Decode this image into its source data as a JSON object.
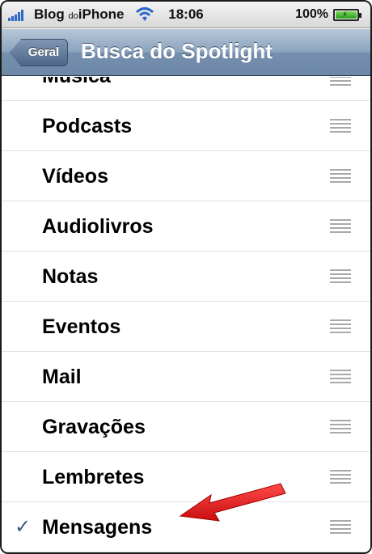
{
  "status_bar": {
    "carrier_main": "Blog",
    "carrier_small": "do",
    "carrier_end": "iPhone",
    "time": "18:06",
    "battery_percent": "100%"
  },
  "nav": {
    "back_label": "Geral",
    "title": "Busca do Spotlight"
  },
  "list": {
    "partial_item": "Música",
    "items": [
      {
        "label": "Podcasts",
        "checked": false
      },
      {
        "label": "Vídeos",
        "checked": false
      },
      {
        "label": "Audiolivros",
        "checked": false
      },
      {
        "label": "Notas",
        "checked": false
      },
      {
        "label": "Eventos",
        "checked": false
      },
      {
        "label": "Mail",
        "checked": false
      },
      {
        "label": "Gravações",
        "checked": false
      },
      {
        "label": "Lembretes",
        "checked": false
      },
      {
        "label": "Mensagens",
        "checked": true
      }
    ],
    "check_glyph": "✓"
  },
  "icons": {
    "reorder": "reorder-handle-icon",
    "annotation": "red-arrow-icon"
  },
  "colors": {
    "nav_bar": "#7590ae",
    "checkmark": "#3b5788",
    "arrow": "#e01b1b"
  }
}
